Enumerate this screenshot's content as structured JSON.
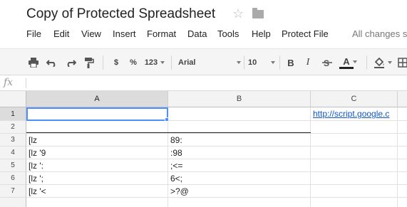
{
  "document": {
    "title": "Copy of Protected Spreadsheet",
    "star_icon": "star-icon",
    "folder_icon": "folder-icon"
  },
  "menu": [
    "File",
    "Edit",
    "View",
    "Insert",
    "Format",
    "Data",
    "Tools",
    "Help",
    "Protect File"
  ],
  "status": "All changes s",
  "toolbar": {
    "currency": "$",
    "percent": "%",
    "number_format": "123",
    "font": "Arial",
    "font_size": "10",
    "bold": "B",
    "italic": "I",
    "text_color": "A"
  },
  "formula_bar": {
    "fx_label": "fx",
    "value": ""
  },
  "columns": [
    "A",
    "B",
    "C"
  ],
  "rows": [
    "1",
    "2",
    "3",
    "4",
    "5",
    "6",
    "7",
    ""
  ],
  "cells": {
    "c1": "http://script.google.c",
    "a3": "[lz",
    "b3": "89:",
    "a4": "[lz '9",
    "b4": ":98",
    "a5": "[lz ':",
    "b5": ";<=",
    "a6": "[lz ';",
    "b6": "6<;",
    "a7": "[lz '<",
    "b7": ">?@"
  },
  "colors": {
    "accent": "#4d90fe",
    "link": "#1155cc"
  }
}
